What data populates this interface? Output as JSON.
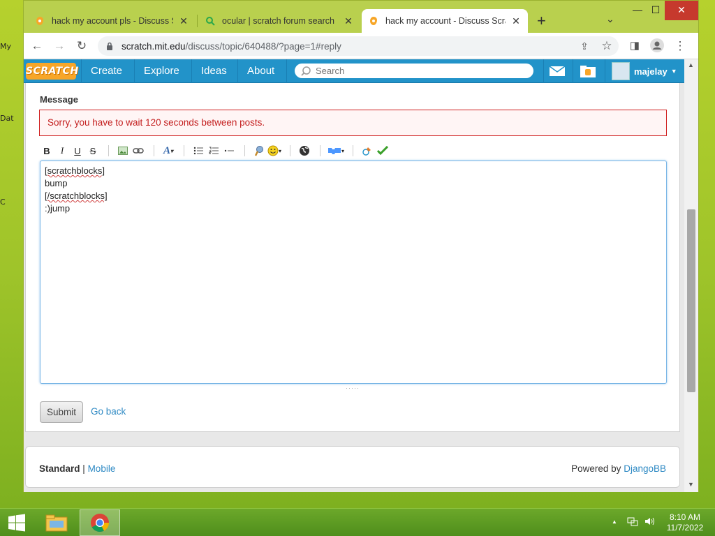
{
  "desktop": {
    "icon_labels": [
      "My",
      "Dat",
      "C"
    ]
  },
  "browser": {
    "tabs": [
      {
        "title": "hack my account pls - Discuss Scratch",
        "active": false
      },
      {
        "title": "ocular | scratch forum search",
        "active": false
      },
      {
        "title": "hack my account - Discuss Scratch",
        "active": true
      }
    ],
    "url_host": "scratch.mit.edu",
    "url_path": "/discuss/topic/640488/?page=1#reply"
  },
  "site": {
    "logo": "SCRATCH",
    "nav": [
      "Create",
      "Explore",
      "Ideas",
      "About"
    ],
    "search_placeholder": "Search",
    "username": "majelay"
  },
  "form": {
    "message_label": "Message",
    "error": "Sorry, you have to wait 120 seconds between posts.",
    "editor_buttons": {
      "bold": "B",
      "italic": "I",
      "underline": "U",
      "strike": "S"
    },
    "text_lines": [
      "[scratchblocks]",
      "bump",
      "[/scratchblocks]",
      ":)jump"
    ],
    "submit": "Submit",
    "go_back": "Go back"
  },
  "footer": {
    "standard": "Standard",
    "separator": "|",
    "mobile": "Mobile",
    "powered_by": "Powered by",
    "djangobb": "DjangoBB"
  },
  "taskbar": {
    "time": "8:10 AM",
    "date": "11/7/2022"
  },
  "colors": {
    "scratch_blue": "#2293c9",
    "error_red": "#c41f1f",
    "link_blue": "#2f8ac4",
    "desktop_green": "#9fc42a"
  }
}
